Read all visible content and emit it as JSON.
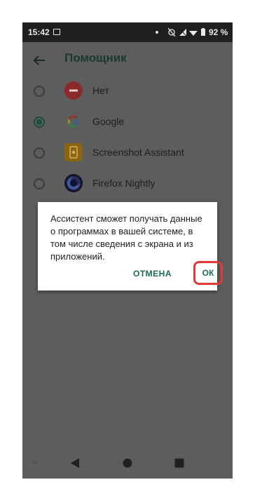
{
  "status_bar": {
    "time": "15:42",
    "battery": "92 %"
  },
  "app_bar": {
    "title": "Помощник"
  },
  "options": [
    {
      "label": "Нет",
      "checked": false,
      "icon": "no-entry-icon"
    },
    {
      "label": "Google",
      "checked": true,
      "icon": "google-icon"
    },
    {
      "label": "Screenshot Assistant",
      "checked": false,
      "icon": "screenshot-assistant-icon"
    },
    {
      "label": "Firefox Nightly",
      "checked": false,
      "icon": "firefox-nightly-icon"
    }
  ],
  "dialog": {
    "message": "Ассистент сможет получать данные о программах в вашей системе, в том числе сведения с экрана и из приложений.",
    "cancel_label": "ОТМЕНА",
    "ok_label": "ОК"
  },
  "colors": {
    "accent": "#1e6a52",
    "highlight": "#e53935",
    "scrim": "#5d5d5d"
  }
}
